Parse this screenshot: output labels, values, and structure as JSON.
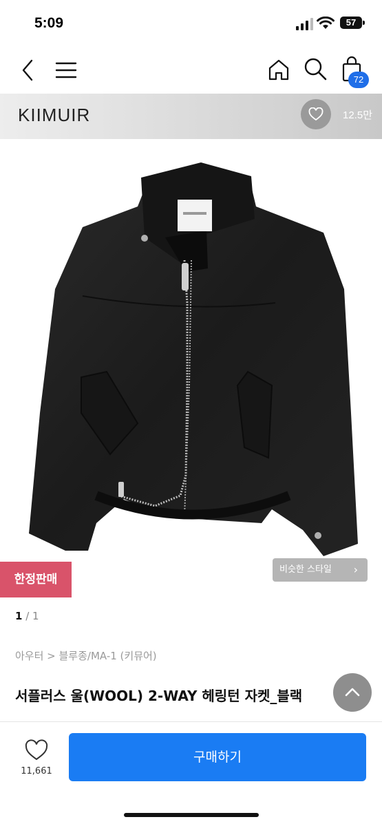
{
  "status_bar": {
    "time": "5:09",
    "battery": "57"
  },
  "nav": {
    "cart_count": "72",
    "icons": [
      "chevron-left-icon",
      "hamburger-menu-icon",
      "home-icon",
      "search-icon",
      "shopping-bag-icon"
    ]
  },
  "brand": {
    "name": "KIIMUIR",
    "like_count": "12.5만"
  },
  "product": {
    "limited_label": "한정판매",
    "similar_label": "비슷한 스타일",
    "pager_current": "1",
    "pager_rest": " / 1",
    "breadcrumb": "아우터 > 블루종/MA-1 (키뮤어)",
    "title": "서플러스 울(WOOL) 2-WAY 헤링턴 자켓_블랙"
  },
  "bottom_bar": {
    "wish_count": "11,661",
    "buy_label": "구매하기"
  },
  "colors": {
    "buy_button": "#1a7cf3",
    "cart_badge": "#1f6ee8",
    "limited_badge": "#d9536a"
  }
}
